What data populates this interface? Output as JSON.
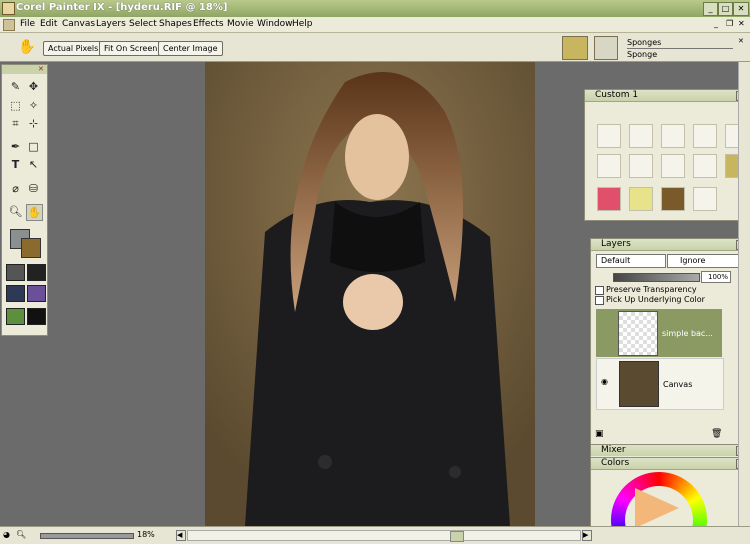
{
  "window": {
    "title": "Corel Painter IX - [hyderu.RIF @ 18%]",
    "min": "_",
    "max": "□",
    "close": "✕"
  },
  "menu": [
    "File",
    "Edit",
    "Canvas",
    "Layers",
    "Select",
    "Shapes",
    "Effects",
    "Movie",
    "Window",
    "Help"
  ],
  "propbar": {
    "actual_pixels": "Actual Pixels",
    "fit_on_screen": "Fit On Screen",
    "center_image": "Center Image",
    "brush_category": "Sponges",
    "brush_variant": "Sponge"
  },
  "custom_palette": {
    "title": "Custom 1"
  },
  "layers_palette": {
    "title": "Layers",
    "composite_method": "Default",
    "composite_depth": "Ignore",
    "opacity": "100%",
    "preserve_transparency": "Preserve Transparency",
    "pick_up_underlying": "Pick Up Underlying Color",
    "layers": [
      {
        "name": "simple bac..."
      },
      {
        "name": "Canvas"
      }
    ]
  },
  "mixer_palette": {
    "title": "Mixer"
  },
  "colors_palette": {
    "title": "Colors"
  },
  "status": {
    "zoom": "18%"
  },
  "colors": {
    "accent": "#8fa663",
    "primary_color": "#8c8f8f",
    "secondary_color": "#8b6a2d"
  }
}
